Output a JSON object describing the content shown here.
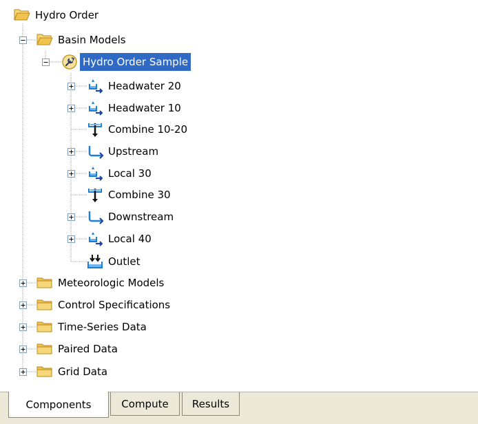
{
  "tree": {
    "root": {
      "label": "Hydro Order",
      "icon": "folder-open-icon"
    },
    "basin_models": {
      "label": "Basin Models",
      "icon": "folder-open-icon"
    },
    "basin": {
      "label": "Hydro Order Sample",
      "icon": "basin-model-icon",
      "selected": true
    },
    "elements": [
      {
        "label": "Headwater 20",
        "icon": "subbasin-icon"
      },
      {
        "label": "Headwater 10",
        "icon": "subbasin-icon"
      },
      {
        "label": "Combine 10-20",
        "icon": "junction-icon"
      },
      {
        "label": "Upstream",
        "icon": "reach-icon"
      },
      {
        "label": "Local 30",
        "icon": "subbasin-icon"
      },
      {
        "label": "Combine 30",
        "icon": "junction-icon"
      },
      {
        "label": "Downstream",
        "icon": "reach-icon"
      },
      {
        "label": "Local 40",
        "icon": "subbasin-icon"
      },
      {
        "label": "Outlet",
        "icon": "sink-icon"
      }
    ],
    "folders": [
      {
        "label": "Meteorologic Models",
        "icon": "folder-icon"
      },
      {
        "label": "Control Specifications",
        "icon": "folder-icon"
      },
      {
        "label": "Time-Series Data",
        "icon": "folder-icon"
      },
      {
        "label": "Paired Data",
        "icon": "folder-icon"
      },
      {
        "label": "Grid Data",
        "icon": "folder-icon"
      }
    ]
  },
  "tabs": [
    {
      "label": "Components",
      "active": true
    },
    {
      "label": "Compute",
      "active": false
    },
    {
      "label": "Results",
      "active": false
    }
  ],
  "colors": {
    "selection": "#316ac5",
    "folder": "#f0c44c",
    "water": "#1c7fd6",
    "panel": "#ece9d8"
  }
}
